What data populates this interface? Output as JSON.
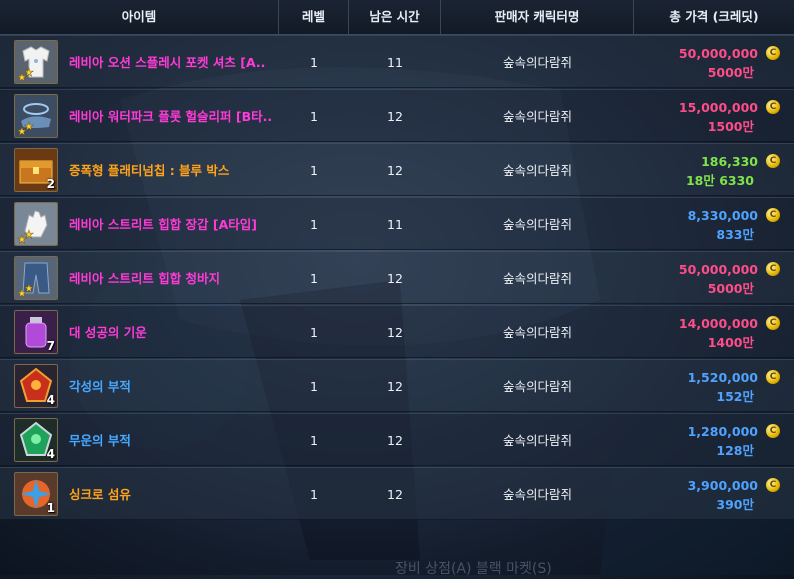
{
  "header": {
    "item": "아이템",
    "level": "레벨",
    "time": "남은 시간",
    "seller": "판매자 캐릭터명",
    "price": "총 가격 (크레딧)"
  },
  "colors": {
    "name_magenta": "#ff3ad7",
    "name_orange": "#ffa31a",
    "name_blue": "#47a8ff",
    "price_pink": "#ff4d8a",
    "price_green": "#7fe34a",
    "price_blue": "#4fa3ff"
  },
  "rows": [
    {
      "name": "레비아 오션 스플레시 포켓 셔츠 [A..",
      "name_color": "magenta",
      "icon": "shirt-icon",
      "qty": "",
      "stars": true,
      "level": "1",
      "time": "11",
      "seller": "숲속의다람쥐",
      "price": "50,000,000",
      "price_short": "5000만",
      "price_color": "pink"
    },
    {
      "name": "레비아 워터파크 플롯 헐슬리퍼 [B타..",
      "name_color": "magenta",
      "icon": "slipper-icon",
      "qty": "",
      "stars": true,
      "level": "1",
      "time": "12",
      "seller": "숲속의다람쥐",
      "price": "15,000,000",
      "price_short": "1500만",
      "price_color": "pink"
    },
    {
      "name": "증폭형 플래티넘칩 : 블루 박스",
      "name_color": "orange",
      "icon": "box-icon",
      "qty": "2",
      "stars": false,
      "level": "1",
      "time": "12",
      "seller": "숲속의다람쥐",
      "price": "186,330",
      "price_short": "18만 6330",
      "price_color": "green"
    },
    {
      "name": "레비아 스트리트 힙합 장갑 [A타입]",
      "name_color": "magenta",
      "icon": "glove-icon",
      "qty": "",
      "stars": true,
      "level": "1",
      "time": "11",
      "seller": "숲속의다람쥐",
      "price": "8,330,000",
      "price_short": "833만",
      "price_color": "blue"
    },
    {
      "name": "레비아 스트리트 힙합 청바지",
      "name_color": "magenta",
      "icon": "jeans-icon",
      "qty": "",
      "stars": true,
      "level": "1",
      "time": "12",
      "seller": "숲속의다람쥐",
      "price": "50,000,000",
      "price_short": "5000만",
      "price_color": "pink"
    },
    {
      "name": "대 성공의 기운",
      "name_color": "magenta",
      "icon": "potion-icon",
      "qty": "7",
      "stars": false,
      "level": "1",
      "time": "12",
      "seller": "숲속의다람쥐",
      "price": "14,000,000",
      "price_short": "1400만",
      "price_color": "pink"
    },
    {
      "name": "각성의 부적",
      "name_color": "blue",
      "icon": "red-amulet-icon",
      "qty": "4",
      "stars": false,
      "level": "1",
      "time": "12",
      "seller": "숲속의다람쥐",
      "price": "1,520,000",
      "price_short": "152만",
      "price_color": "blue"
    },
    {
      "name": "무운의 부적",
      "name_color": "blue",
      "icon": "green-amulet-icon",
      "qty": "4",
      "stars": false,
      "level": "1",
      "time": "12",
      "seller": "숲속의다람쥐",
      "price": "1,280,000",
      "price_short": "128만",
      "price_color": "blue"
    },
    {
      "name": "싱크로 섬유",
      "name_color": "orange",
      "icon": "fiber-icon",
      "qty": "1",
      "stars": false,
      "level": "1",
      "time": "12",
      "seller": "숲속의다람쥐",
      "price": "3,900,000",
      "price_short": "390만",
      "price_color": "blue"
    }
  ],
  "footer": {
    "text": "장비 상점(A)          블랙 마켓(S)"
  }
}
